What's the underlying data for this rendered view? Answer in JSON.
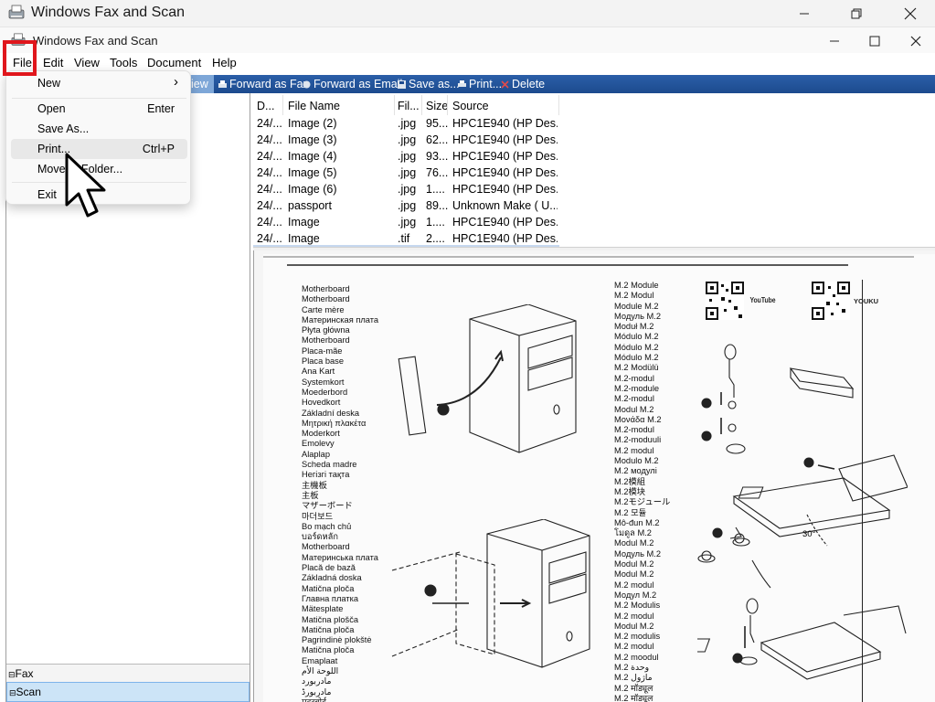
{
  "outer_window": {
    "title": "Windows Fax and Scan"
  },
  "inner_window": {
    "title": "Windows Fax and Scan"
  },
  "menubar": {
    "items": [
      "File",
      "Edit",
      "View",
      "Tools",
      "Document",
      "Help"
    ]
  },
  "file_menu": {
    "items": [
      {
        "label": "New",
        "shortcut": "",
        "submenu_arrow": "›"
      },
      {
        "label": "Open",
        "shortcut": "Enter"
      },
      {
        "label": "Save As...",
        "shortcut": ""
      },
      {
        "label": "Print...",
        "shortcut": "Ctrl+P"
      },
      {
        "label": "Move to Folder...",
        "shortcut": ""
      },
      {
        "label": "Exit",
        "shortcut": ""
      }
    ]
  },
  "toolbar": {
    "view_fragment": "iew",
    "items": [
      "Forward as Fax",
      "Forward as Email",
      "Save as...",
      "Print...",
      "Delete"
    ]
  },
  "navigation": {
    "items": [
      "Fax",
      "Scan"
    ]
  },
  "file_list": {
    "columns": [
      "D...",
      "File Name",
      "Fil...",
      "Size",
      "Source"
    ],
    "rows": [
      [
        "24/...",
        "Image (2)",
        ".jpg",
        "95...",
        "HPC1E940 (HP Des..."
      ],
      [
        "24/...",
        "Image (3)",
        ".jpg",
        "62...",
        "HPC1E940 (HP Des..."
      ],
      [
        "24/...",
        "Image (4)",
        ".jpg",
        "93...",
        "HPC1E940 (HP Des..."
      ],
      [
        "24/...",
        "Image (5)",
        ".jpg",
        "76...",
        "HPC1E940 (HP Des..."
      ],
      [
        "24/...",
        "Image (6)",
        ".jpg",
        "1....",
        "HPC1E940 (HP Des..."
      ],
      [
        "24/...",
        "passport",
        ".jpg",
        "89...",
        "Unknown Make ( U..."
      ],
      [
        "24/...",
        "Image",
        ".jpg",
        "1....",
        "HPC1E940 (HP Des..."
      ],
      [
        "24/...",
        "Image",
        ".tif",
        "2....",
        "HPC1E940 (HP Des..."
      ]
    ]
  },
  "preview": {
    "motherboard_words": "Motherboard\nMotherboard\nCarte mère\nМатеринская плата\nPłyta główna\nMotherboard\nPlaca-mãe\nPlaca base\nAna Kart\nSystemkort\nMoederbord\nHovedkort\nZákladní deska\nΜητρική πλακέτα\nModerkort\nEmolevy\nAlaplap\nScheda madre\nНегізгі тақта\n主機板\n主板\nマザーボード\n마더보드\nBo mạch chủ\nบอร์ดหลัก\nMotherboard\nМатеринська плата\nPlacă de bază\nZákladná doska\nMatična ploča\nГлавна платка\nMätesplate\nMatična plošča\nMatična ploča\nPagrindinė plokštė\nMatična ploča\nEmaplaat\nاللوحة الأم\nمادربورد\nمادربورڈ\nमदरबोर्ड",
    "m2_words": "M.2 Module\nM.2 Modul\nModule M.2\nМодуль M.2\nModuł M.2\nMódulo M.2\nMódulo M.2\nMódulo M.2\nM.2 Modülü\nM.2-modul\nM.2-module\nM.2-modul\nModul M.2\nΜονάδα M.2\nM.2-modul\nM.2-moduuli\nM.2 modul\nModulo M.2\nM.2 модулі\nM.2模組\nM.2模块\nM.2モジュール\nM.2 모듈\nMô-đun M.2\nโมดูล M.2\nModul M.2\nМодуль M.2\nModul M.2\nModul M.2\nM.2 modul\nМодул M.2\nM.2 Modulis\nM.2 modul\nModul M.2\nM.2 modulis\nM.2 modul\nM.2 moodul\nM.2 وحدة\nM.2 ماژول\nM.2 मॉड्यूल\nM.2 मॉड्यूल",
    "labels": {
      "youtube": "YouTube",
      "youku": "YOUKU",
      "angle": "30°"
    }
  },
  "colors": {
    "toolbar": "#1f4e96",
    "highlight_box": "#e0161c",
    "nav_selected": "#cce4f7"
  }
}
